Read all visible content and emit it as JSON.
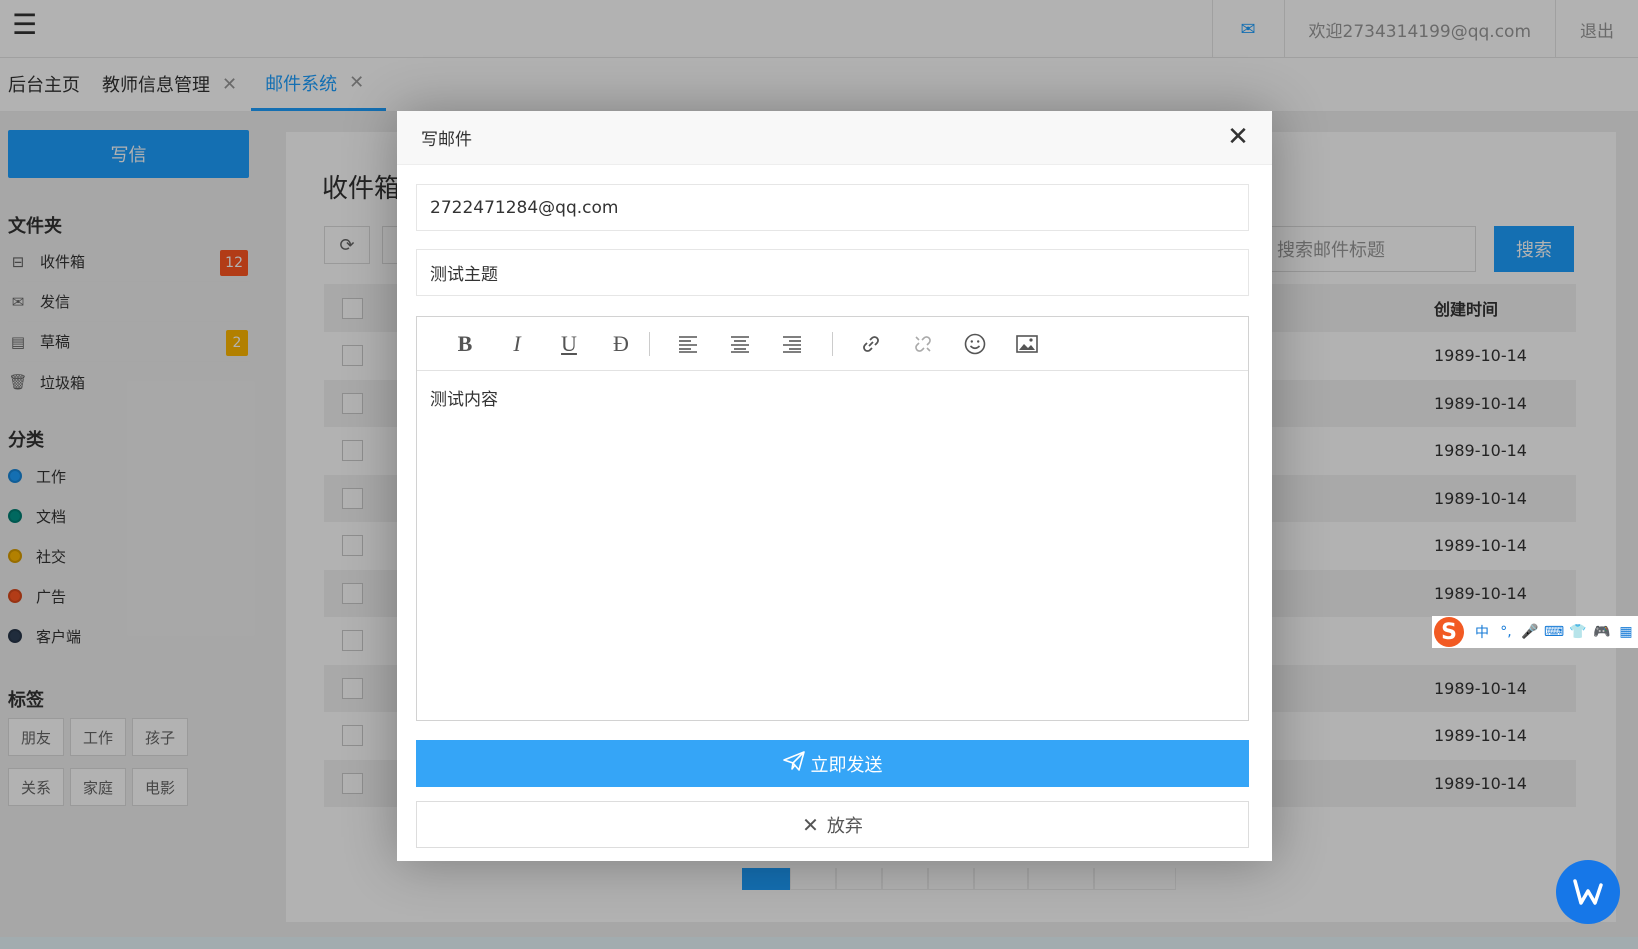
{
  "topbar": {
    "menu_icon": "hamburger-icon",
    "mail_icon": "envelope-icon",
    "welcome": "欢迎2734314199@qq.com",
    "logout": "退出"
  },
  "tabs": [
    {
      "label": "后台主页",
      "closable": false
    },
    {
      "label": "教师信息管理",
      "closable": true
    },
    {
      "label": "邮件系统",
      "closable": true,
      "active": true
    }
  ],
  "sidebar": {
    "write_label": "写信",
    "folders_title": "文件夹",
    "folders": [
      {
        "label": "收件箱",
        "icon": "inbox-icon",
        "badge": "12",
        "badge_color": "#ff5722"
      },
      {
        "label": "发信",
        "icon": "envelope-icon",
        "badge": "",
        "badge_color": ""
      },
      {
        "label": "草稿",
        "icon": "draft-icon",
        "badge": "2",
        "badge_color": "#ffb800"
      },
      {
        "label": "垃圾箱",
        "icon": "trash-icon",
        "badge": "",
        "badge_color": ""
      }
    ],
    "categories_title": "分类",
    "categories": [
      {
        "label": "工作",
        "color": "#1e9fff"
      },
      {
        "label": "文档",
        "color": "#009688"
      },
      {
        "label": "社交",
        "color": "#ffb800"
      },
      {
        "label": "广告",
        "color": "#ff5722"
      },
      {
        "label": "客户端",
        "color": "#2f4056"
      }
    ],
    "tags_title": "标签",
    "tags": [
      "朋友",
      "工作",
      "孩子",
      "关系",
      "家庭",
      "电影"
    ]
  },
  "main": {
    "title": "收件箱",
    "search_placeholder": "搜索邮件标题",
    "search_label": "搜索",
    "table_header_date": "创建时间",
    "rows": [
      "1989-10-14",
      "1989-10-14",
      "1989-10-14",
      "1989-10-14",
      "1989-10-14",
      "1989-10-14",
      "",
      "1989-10-14",
      "1989-10-14",
      "1989-10-14"
    ]
  },
  "modal": {
    "title": "写邮件",
    "to_value": "2722471284@qq.com",
    "subject_value": "测试主题",
    "body_value": "测试内容",
    "toolbar": [
      "B",
      "I",
      "U",
      "Ð"
    ],
    "send_label": "立即发送",
    "discard_label": "放弃"
  },
  "ime": {
    "logo": "S",
    "mode": "中"
  },
  "colors": {
    "accent": "#1e9fff",
    "send": "#35a5f7"
  }
}
